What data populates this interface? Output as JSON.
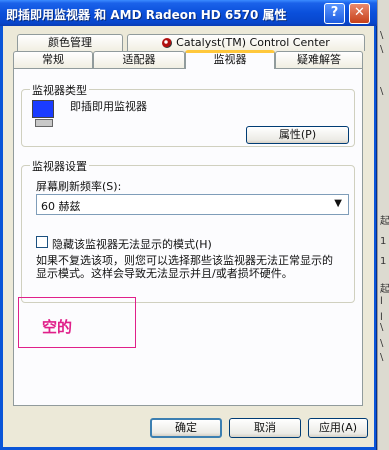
{
  "window": {
    "title": "即插即用监视器 和 AMD Radeon HD 6570 属性",
    "help_button": "?",
    "close_button": "✕"
  },
  "tabs_row1": [
    {
      "label": "颜色管理"
    },
    {
      "label": "Catalyst(TM) Control Center"
    }
  ],
  "tabs_row2": [
    {
      "label": "常规"
    },
    {
      "label": "适配器"
    },
    {
      "label": "监视器",
      "active": true
    },
    {
      "label": "疑难解答"
    }
  ],
  "monitor_type": {
    "group_title": "监视器类型",
    "monitor_name": "即插即用监视器",
    "properties_button": "属性(P)"
  },
  "monitor_settings": {
    "group_title": "监视器设置",
    "refresh_label": "屏幕刷新频率(S):",
    "refresh_value": "60 赫兹",
    "hide_modes_label": "隐藏该监视器无法显示的模式(H)",
    "hide_modes_checked": false,
    "description_line1": "如果不复选该项，则您可以选择那些该监视器无法正常显示的",
    "description_line2": "显示模式。这样会导致无法显示并且/或者损坏硬件。"
  },
  "annotation": {
    "text": "空的",
    "color": "#e0208a"
  },
  "footer": {
    "ok_button": "确定",
    "cancel_button": "取消",
    "apply_button": "应用(A)"
  },
  "right_strip": {
    "chars": [
      "\\",
      "\\",
      "\\",
      "起",
      "1",
      "1",
      "起",
      "l",
      "l",
      "\\",
      "\\",
      "\\"
    ]
  }
}
